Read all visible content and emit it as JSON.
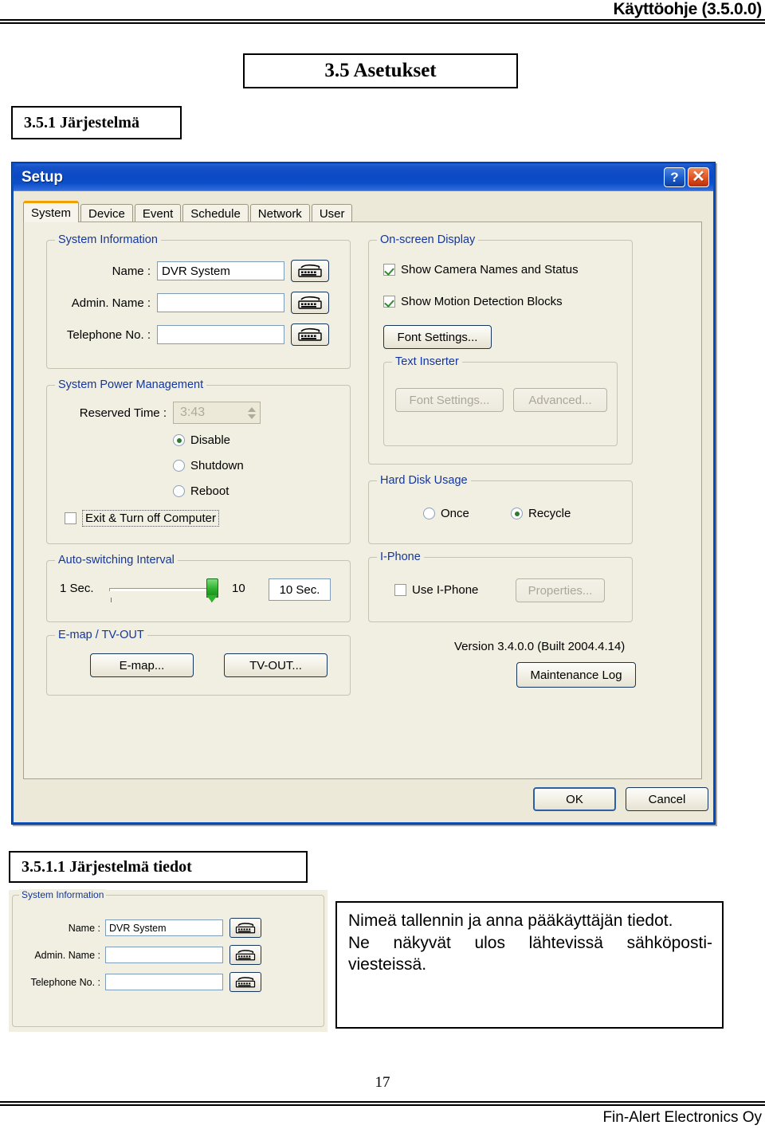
{
  "page": {
    "header_title": "Käyttöohje (3.5.0.0)",
    "heading_35": "3.5 Asetukset",
    "heading_351": "3.5.1 Järjestelmä",
    "heading_3511": "3.5.1.1 Järjestelmä tiedot",
    "page_number": "17",
    "footer_company": "Fin-Alert Electronics Oy"
  },
  "dialog": {
    "title": "Setup",
    "help_button": "?",
    "close_button": "✕",
    "tabs": [
      {
        "label": "System",
        "active": true
      },
      {
        "label": "Device",
        "active": false
      },
      {
        "label": "Event",
        "active": false
      },
      {
        "label": "Schedule",
        "active": false
      },
      {
        "label": "Network",
        "active": false
      },
      {
        "label": "User",
        "active": false
      }
    ],
    "system_information": {
      "legend": "System Information",
      "fields": [
        {
          "label": "Name :",
          "value": "DVR System"
        },
        {
          "label": "Admin. Name :",
          "value": ""
        },
        {
          "label": "Telephone No. :",
          "value": ""
        }
      ],
      "keyboard_button_title": "keyboard"
    },
    "power_management": {
      "legend": "System Power Management",
      "reserved_time_label": "Reserved Time :",
      "reserved_time_value": "3:43",
      "options": [
        {
          "label": "Disable",
          "selected": true
        },
        {
          "label": "Shutdown",
          "selected": false
        },
        {
          "label": "Reboot",
          "selected": false
        }
      ],
      "exit_checkbox_label": "Exit & Turn off Computer",
      "exit_checkbox_checked": false
    },
    "auto_switching": {
      "legend": "Auto-switching Interval",
      "min_label": "1 Sec.",
      "value": "10",
      "value_box": "10 Sec."
    },
    "emap_tvout": {
      "legend": "E-map / TV-OUT",
      "emap_button": "E-map...",
      "tvout_button": "TV-OUT..."
    },
    "osd": {
      "legend": "On-screen Display",
      "checkboxes": [
        {
          "label": "Show Camera Names and Status",
          "checked": true
        },
        {
          "label": "Show Motion Detection Blocks",
          "checked": true
        }
      ],
      "font_settings_button": "Font Settings...",
      "text_inserter": {
        "legend": "Text Inserter",
        "font_settings_button": "Font Settings...",
        "advanced_button": "Advanced..."
      }
    },
    "hard_disk_usage": {
      "legend": "Hard Disk Usage",
      "options": [
        {
          "label": "Once",
          "selected": false
        },
        {
          "label": "Recycle",
          "selected": true
        }
      ]
    },
    "iphone": {
      "legend": "I-Phone",
      "checkbox_label": "Use I-Phone",
      "checkbox_checked": false,
      "properties_button": "Properties..."
    },
    "version_text": "Version 3.4.0.0 (Built  2004.4.14)",
    "maintenance_log_button": "Maintenance Log",
    "ok_button": "OK",
    "cancel_button": "Cancel"
  },
  "snippet": {
    "legend": "System Information",
    "fields": [
      {
        "label": "Name :",
        "value": "DVR System"
      },
      {
        "label": "Admin. Name :",
        "value": ""
      },
      {
        "label": "Telephone No. :",
        "value": ""
      }
    ]
  },
  "note": {
    "line1": "Nimeä tallennin ja anna pääkäyttäjän tiedot.",
    "line2_words": [
      "Ne",
      "näkyvät",
      "ulos",
      "lähtevissä",
      "sähköposti-"
    ],
    "line3": "viesteissä."
  },
  "colors": {
    "titlebar_blue": "#0b49c4",
    "legend_blue": "#14369c",
    "active_tab_orange": "#f0a000",
    "slider_green": "#2cb22c",
    "dialog_face": "#ece9d8"
  }
}
